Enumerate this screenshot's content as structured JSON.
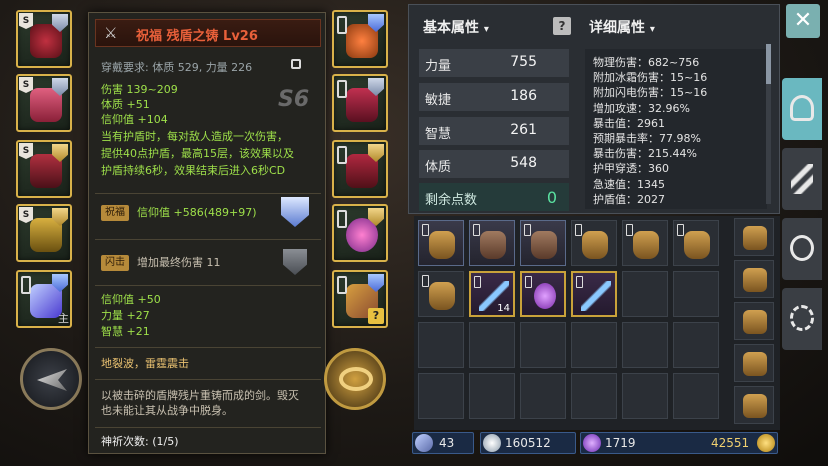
{
  "tooltip": {
    "title": "祝福 残盾之铸 Lv26",
    "requirement": "穿戴要求: 体质 529, 力量 226",
    "grade": "S6",
    "stats": [
      "伤害 139~209",
      "体质 +51",
      "信仰值 +104"
    ],
    "effect": [
      "当有护盾时，每对敌人造成一次伤害，",
      "提供40点护盾，最高15层，该效果以及",
      "护盾持续6秒，效果结束后进入6秒CD"
    ],
    "bless_tag": "祝福",
    "bless_text": "信仰值 +586(489+97)",
    "flash_tag": "闪击",
    "flash_text": "增加最终伤害 11",
    "extra_stats": [
      "信仰值 +50",
      "力量 +27",
      "智慧 +21"
    ],
    "skills": "地裂波，雷霆震击",
    "lore": [
      "以被击碎的盾牌残片重铸而成的剑。毁灭",
      "也未能让其从战争中脱身。"
    ],
    "prayer": "神祈次数: (1/5)"
  },
  "basic": {
    "header": "基本属性",
    "rows": [
      {
        "label": "力量",
        "value": "755"
      },
      {
        "label": "敏捷",
        "value": "186"
      },
      {
        "label": "智慧",
        "value": "261"
      },
      {
        "label": "体质",
        "value": "548"
      }
    ],
    "points_label": "剩余点数",
    "points_value": "0"
  },
  "detail": {
    "header": "详细属性",
    "lines": [
      "物理伤害：682~756",
      "附加冰霜伤害：15~16",
      "附加闪电伤害：15~16",
      "增加攻速：32.96%",
      "暴击值：2961",
      "预期暴击率：77.98%",
      "暴击伤害：215.44%",
      "护甲穿透：360",
      "急速值：1345",
      "护盾值：2027"
    ]
  },
  "inventory": {
    "stack_count": "14"
  },
  "currency": {
    "weapon": "43",
    "silver": "160512",
    "crystal": "1719",
    "gold": "42551"
  },
  "icons": {
    "close": "✕",
    "help": "?",
    "equip_lock": "主"
  }
}
